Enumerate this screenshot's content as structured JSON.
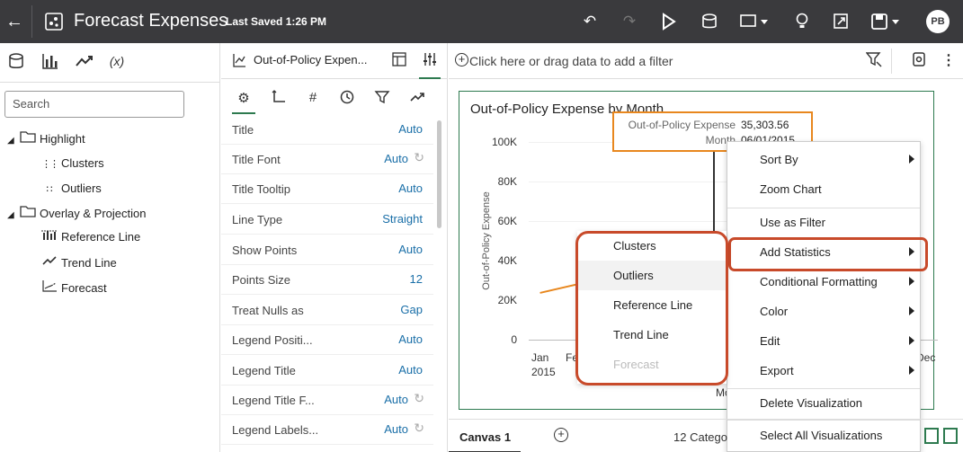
{
  "header": {
    "title": "Forecast Expenses",
    "last_saved": "Last Saved 1:26 PM",
    "avatar_initials": "PB"
  },
  "left_panel": {
    "search_placeholder": "Search",
    "tree": [
      {
        "label": "Highlight",
        "kind": "folder"
      },
      {
        "label": "Clusters",
        "kind": "item",
        "icon": "clusters-icon"
      },
      {
        "label": "Outliers",
        "kind": "item",
        "icon": "outliers-icon"
      },
      {
        "label": "Overlay & Projection",
        "kind": "folder"
      },
      {
        "label": "Reference Line",
        "kind": "item",
        "icon": "reference-line-icon"
      },
      {
        "label": "Trend Line",
        "kind": "item",
        "icon": "trend-line-icon"
      },
      {
        "label": "Forecast",
        "kind": "item",
        "icon": "forecast-icon"
      }
    ]
  },
  "properties": {
    "viz_name": "Out-of-Policy Expen...",
    "rows": [
      {
        "label": "Title",
        "value": "Auto"
      },
      {
        "label": "Title Font",
        "value": "Auto"
      },
      {
        "label": "Title Tooltip",
        "value": "Auto"
      },
      {
        "label": "Line Type",
        "value": "Straight"
      },
      {
        "label": "Show Points",
        "value": "Auto"
      },
      {
        "label": "Points Size",
        "value": "12"
      },
      {
        "label": "Treat Nulls as",
        "value": "Gap"
      },
      {
        "label": "Legend Positi...",
        "value": "Auto"
      },
      {
        "label": "Legend Title",
        "value": "Auto"
      },
      {
        "label": "Legend Title F...",
        "value": "Auto"
      },
      {
        "label": "Legend Labels...",
        "value": "Auto"
      }
    ]
  },
  "filter_bar": {
    "placeholder": "Click here or drag data to add a filter"
  },
  "chart": {
    "title": "Out-of-Policy Expense by Month",
    "y_label": "Out-of-Policy Expense",
    "y_ticks": [
      "100K",
      "80K",
      "60K",
      "40K",
      "20K",
      "0"
    ],
    "x_ticks": [
      "Jan",
      "Fe",
      "Dec"
    ],
    "x_year": "2015",
    "x_partial": "Mo"
  },
  "tooltip": {
    "measure_label": "Out-of-Policy Expense",
    "measure_value": "35,303.56",
    "dim_label": "Month",
    "dim_value": "06/01/2015"
  },
  "context_menu": {
    "items": [
      "Sort By",
      "Zoom Chart",
      "Use as Filter",
      "Add Statistics",
      "Conditional Formatting",
      "Color",
      "Edit",
      "Export",
      "Delete Visualization",
      "Select All Visualizations"
    ]
  },
  "submenu": {
    "items": [
      "Clusters",
      "Outliers",
      "Reference Line",
      "Trend Line",
      "Forecast"
    ]
  },
  "bottom_bar": {
    "canvas_tab": "Canvas 1",
    "category_count": "12 Catego"
  },
  "colors": {
    "accent_green": "#2d7a4f",
    "highlight_orange": "#e8871e",
    "annotation_red": "#c84a2a",
    "topbar": "#3a3a3d",
    "link_blue": "#1a6fa8"
  }
}
